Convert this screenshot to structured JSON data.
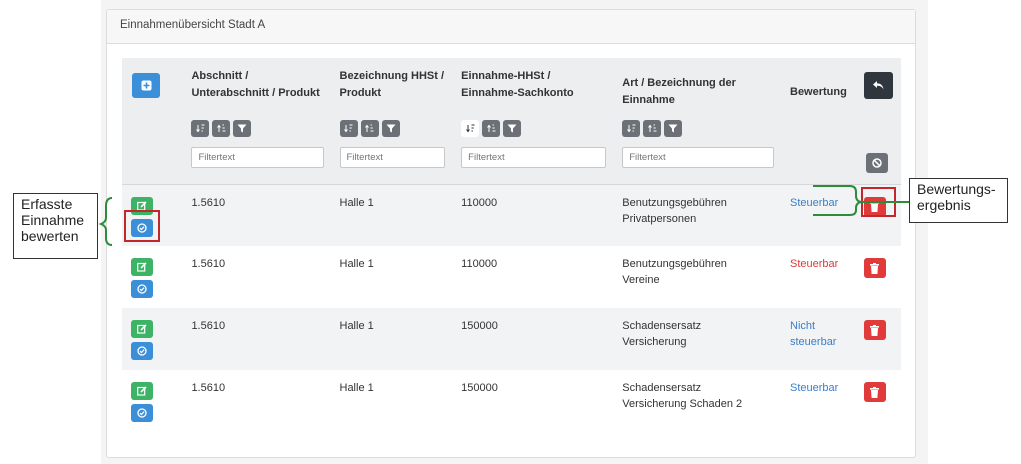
{
  "panel": {
    "title": "Einnahmenübersicht Stadt A"
  },
  "columns": [
    "Abschnitt / Unterabschnitt / Produkt",
    "Bezeichnung HHSt / Produkt",
    "Einnahme-HHSt / Einnahme-Sachkonto",
    "Art / Bezeichnung der Einnahme",
    "Bewertung"
  ],
  "filter_placeholder": "Filtertext",
  "rows": [
    {
      "abschnitt": "1.5610",
      "bezeichnung": "Halle 1",
      "hhst": "110000",
      "art": "Benutzungsgebühren Privatpersonen",
      "bewertung": "Steuerbar",
      "bewertung_color": "#3a7fc7"
    },
    {
      "abschnitt": "1.5610",
      "bezeichnung": "Halle 1",
      "hhst": "110000",
      "art": "Benutzungsgebühren Vereine",
      "bewertung": "Steuerbar",
      "bewertung_color": "#d93b3b"
    },
    {
      "abschnitt": "1.5610",
      "bezeichnung": "Halle 1",
      "hhst": "150000",
      "art": "Schadensersatz Versicherung",
      "bewertung": "Nicht steuerbar",
      "bewertung_color": "#3a7fc7"
    },
    {
      "abschnitt": "1.5610",
      "bezeichnung": "Halle 1",
      "hhst": "150000",
      "art": "Schadensersatz Versicherung Schaden 2",
      "bewertung": "Steuerbar",
      "bewertung_color": "#3a7fc7"
    }
  ],
  "annotations": {
    "left": "Erfasste Einnahme bewerten",
    "right_line1": "Bewertungs-",
    "right_line2": "ergebnis"
  },
  "icons": {
    "add": "plus-square-icon",
    "back": "undo-arrow-icon",
    "sort_asc": "sort-ascending-icon",
    "sort_desc": "sort-descending-icon",
    "filter": "funnel-icon",
    "clear": "ban-icon",
    "edit": "edit-icon",
    "rate": "check-circle-icon",
    "delete": "trash-icon"
  },
  "colors": {
    "primary": "#3a8fd8",
    "success": "#3cb365",
    "danger": "#e03a3a",
    "dark": "#2f363d",
    "annotation_green": "#2e8b3a",
    "highlight_red": "#c0282d"
  }
}
